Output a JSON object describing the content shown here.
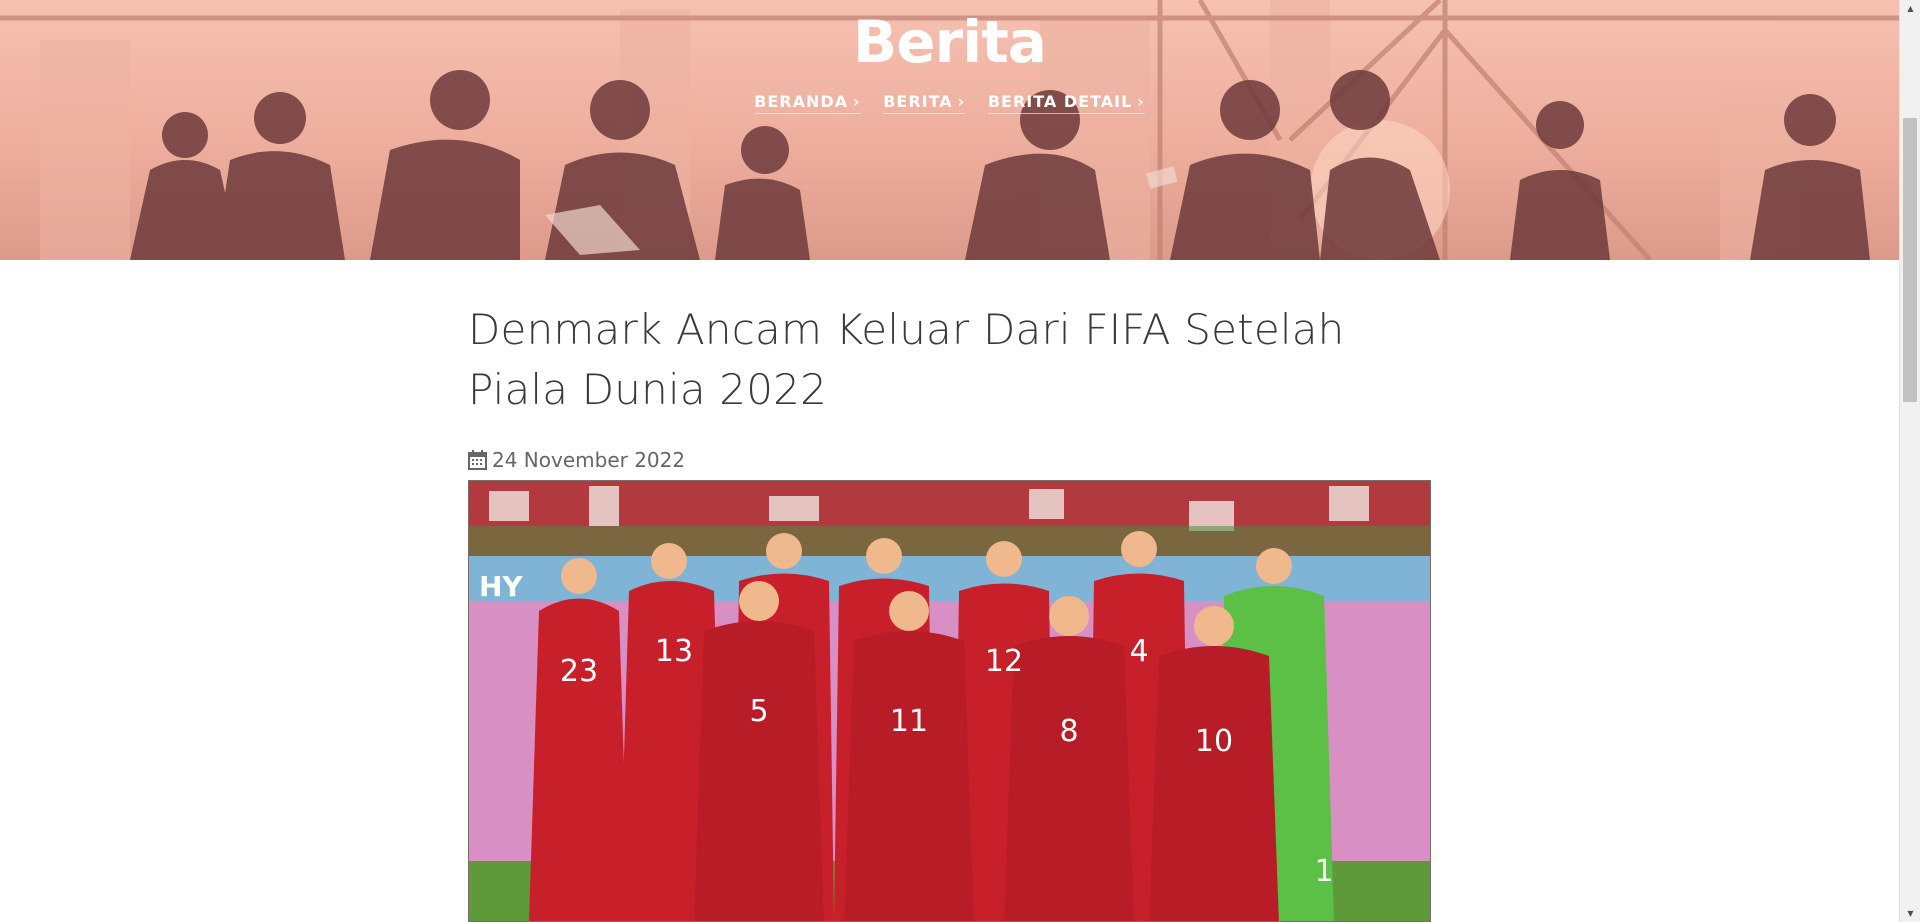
{
  "hero": {
    "title": "Berita",
    "breadcrumbs": [
      {
        "label": "BERANDA"
      },
      {
        "label": "BERITA"
      },
      {
        "label": "BERITA DETAIL"
      }
    ]
  },
  "article": {
    "title": "Denmark Ancam Keluar Dari FIFA Setelah Piala Dunia 2022",
    "date": "24 November 2022",
    "date_icon": "calendar-icon",
    "photo": {
      "jersey_numbers": [
        "23",
        "13",
        "5",
        "11",
        "12",
        "8",
        "4",
        "10",
        "1"
      ],
      "sponsor_text": "HY"
    }
  },
  "colors": {
    "hero_tint": "#f5c1b1",
    "jersey_red": "#c8202a",
    "goalkeeper_green": "#5cbf46",
    "title_text": "#3a3a3a",
    "meta_text": "#666666"
  }
}
